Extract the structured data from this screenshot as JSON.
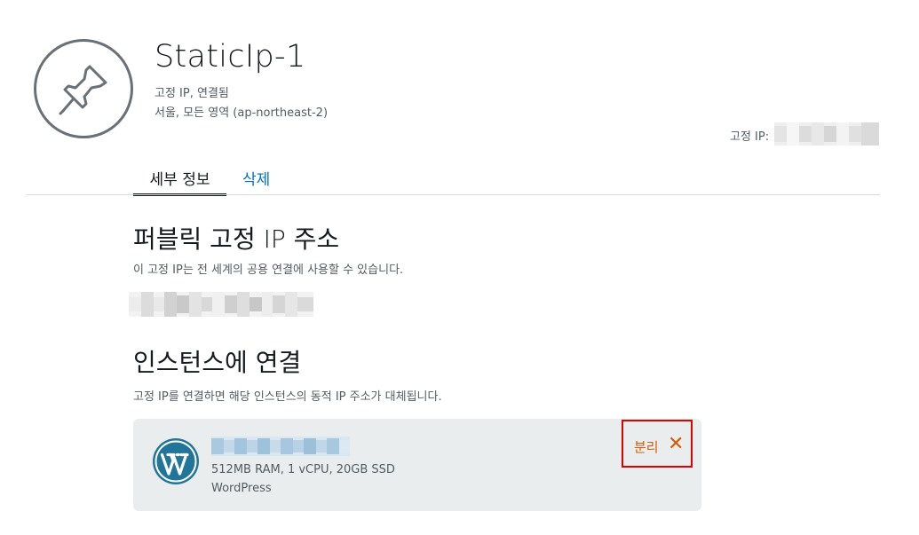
{
  "header": {
    "icon": "pushpin-icon",
    "title": "StaticIp-1",
    "status": "고정 IP, 연결됨",
    "location": "서울, 모든 영역 (ap-northeast-2)",
    "static_ip_label": "고정 IP:"
  },
  "tabs": [
    {
      "label": "세부 정보",
      "active": true
    },
    {
      "label": "삭제",
      "active": false
    }
  ],
  "public_ip": {
    "heading_main": "퍼블릭 고정 ",
    "heading_ip": "IP",
    "heading_tail": " 주소",
    "description": "이 고정 IP는 전 세계의 공용 연결에 사용할 수 있습니다."
  },
  "attach": {
    "heading": "인스턴스에 연결",
    "description": "고정 IP를 연결하면 해당 인스턴스의 동적 IP 주소가 대체됩니다.",
    "instance": {
      "icon": "wordpress-icon",
      "specs": "512MB RAM, 1 vCPU, 20GB SSD",
      "blueprint": "WordPress"
    },
    "detach_label": "분리",
    "detach_icon": "close-icon"
  },
  "colors": {
    "accent_link": "#0073bb",
    "detach_orange": "#d45b07",
    "highlight_red": "#e00000",
    "card_bg": "#eaeded",
    "wordpress_blue": "#21759b"
  }
}
